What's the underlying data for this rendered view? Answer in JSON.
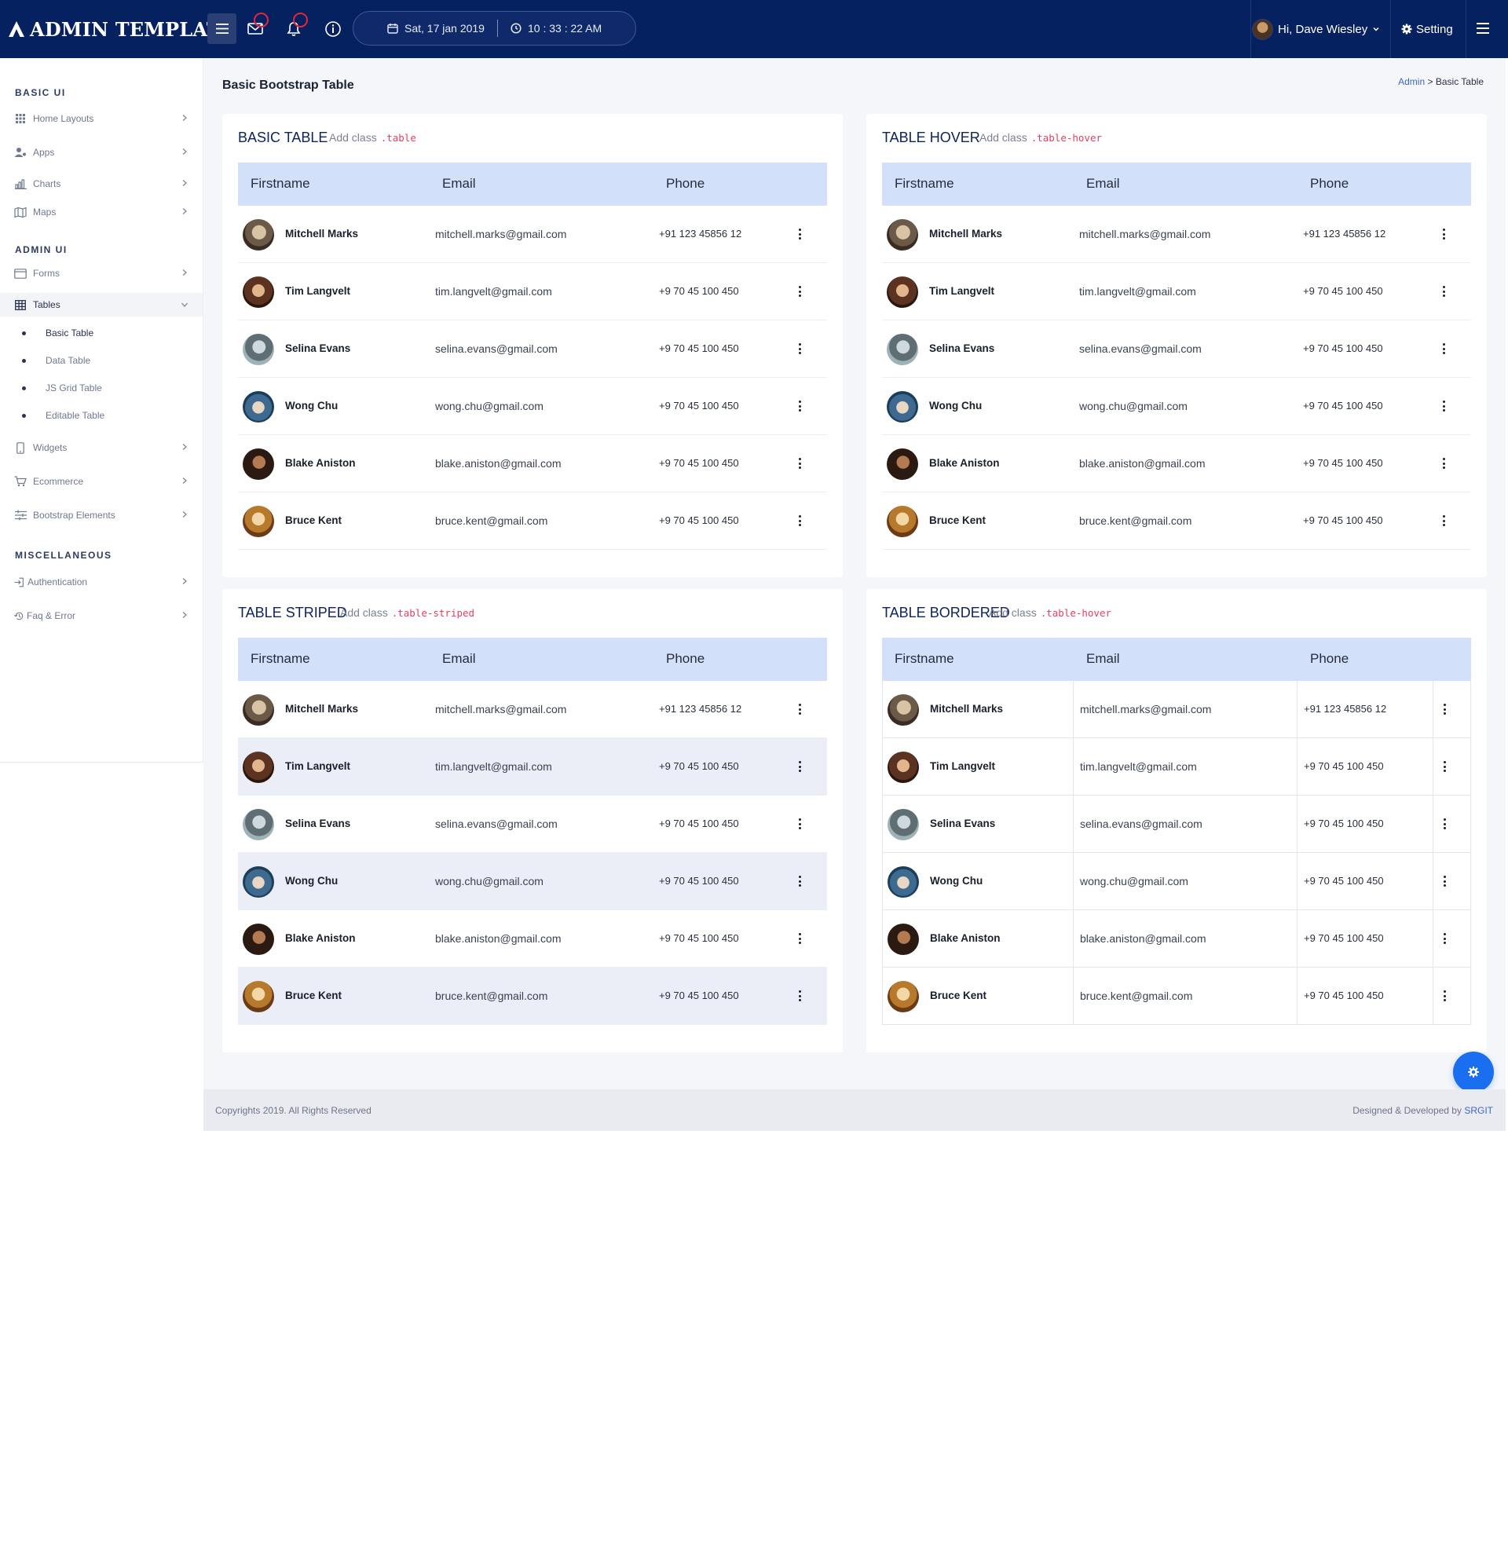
{
  "header": {
    "brand": "ADMIN TEMPLATE",
    "date": "Sat, 17 jan 2019",
    "time": "10 : 33 : 22 AM",
    "user_greeting": "Hi, Dave Wiesley",
    "setting_label": "Setting",
    "accent_color": "#062160",
    "badge_color": "#e0283c"
  },
  "sidebar": {
    "sections": [
      {
        "heading": "BASIC UI",
        "items": [
          {
            "label": "Home Layouts",
            "icon": "grid-icon"
          },
          {
            "label": "Apps",
            "icon": "user-group-icon"
          },
          {
            "label": "Charts",
            "icon": "bar-chart-icon"
          },
          {
            "label": "Maps",
            "icon": "map-icon"
          }
        ]
      },
      {
        "heading": "ADMIN UI",
        "items": [
          {
            "label": "Forms",
            "icon": "window-icon"
          },
          {
            "label": "Tables",
            "icon": "table-icon",
            "expanded": true,
            "children": [
              "Basic Table",
              "Data Table",
              "JS Grid Table",
              "Editable Table"
            ]
          },
          {
            "label": "Widgets",
            "icon": "mobile-icon"
          },
          {
            "label": "Ecommerce",
            "icon": "cart-icon"
          },
          {
            "label": "Bootstrap Elements",
            "icon": "sliders-icon"
          }
        ]
      },
      {
        "heading": "MISCELLANEOUS",
        "items": [
          {
            "label": "Authentication",
            "icon": "login-icon"
          },
          {
            "label": "Faq & Error",
            "icon": "history-icon"
          }
        ]
      }
    ]
  },
  "page": {
    "title": "Basic Bootstrap Table",
    "breadcrumb_root": "Admin",
    "breadcrumb_separator": ">",
    "breadcrumb_current": "Basic Table"
  },
  "table_columns": [
    "Firstname",
    "Email",
    "Phone"
  ],
  "people": [
    {
      "name": "Mitchell Marks",
      "email": "mitchell.marks@gmail.com",
      "phone": "+91 123 45856 12"
    },
    {
      "name": "Tim Langvelt",
      "email": "tim.langvelt@gmail.com",
      "phone": "+9 70 45 100 450"
    },
    {
      "name": "Selina Evans",
      "email": "selina.evans@gmail.com",
      "phone": "+9 70 45 100 450"
    },
    {
      "name": "Wong Chu",
      "email": "wong.chu@gmail.com",
      "phone": "+9 70 45 100 450"
    },
    {
      "name": "Blake Aniston",
      "email": "blake.aniston@gmail.com",
      "phone": "+9 70 45 100 450"
    },
    {
      "name": "Bruce Kent",
      "email": "bruce.kent@gmail.com",
      "phone": "+9 70 45 100 450"
    }
  ],
  "cards": [
    {
      "title": "BASIC TABLE",
      "add_class_label": "Add class",
      "class_name": ".table",
      "variant": "basic"
    },
    {
      "title": "TABLE HOVER",
      "add_class_label": "Add class",
      "class_name": ".table-hover",
      "variant": "hover"
    },
    {
      "title": "TABLE STRIPED",
      "add_class_label": "Add class",
      "class_name": ".table-striped",
      "variant": "striped"
    },
    {
      "title": "TABLE BORDERED",
      "add_class_label": "Add class",
      "class_name": ".table-hover",
      "variant": "bordered"
    }
  ],
  "footer": {
    "copyright": "Copyrights 2019. All Rights Reserved",
    "credit_prefix": "Designed & Developed by",
    "credit_link": "SRGIT"
  }
}
